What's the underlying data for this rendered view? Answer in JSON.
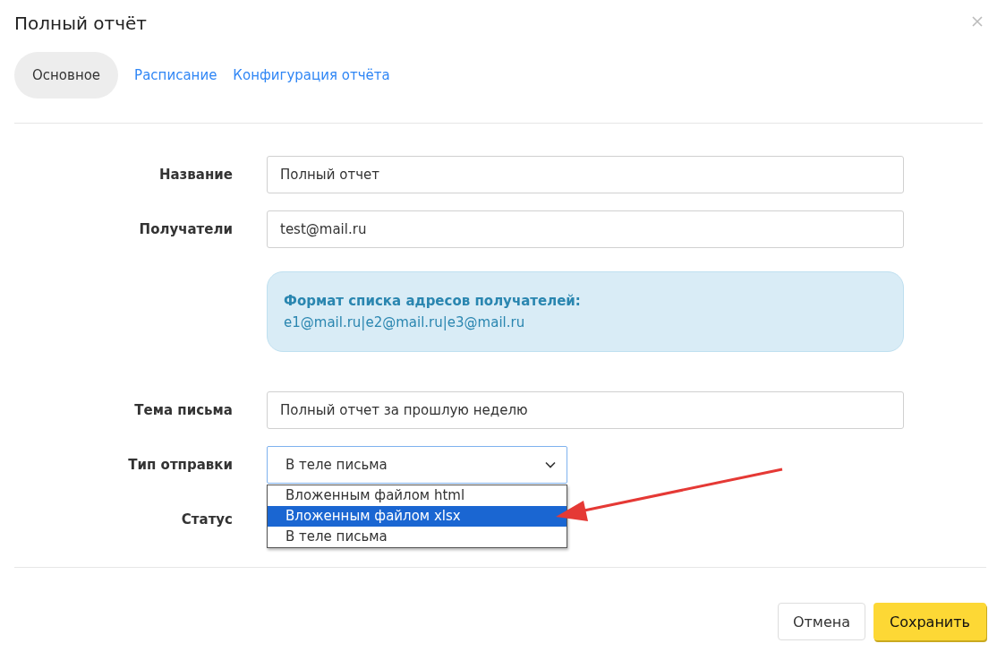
{
  "dialog": {
    "title": "Полный отчёт"
  },
  "tabs": [
    {
      "label": "Основное",
      "selected": true
    },
    {
      "label": "Расписание",
      "selected": false
    },
    {
      "label": "Конфигурация отчёта",
      "selected": false
    }
  ],
  "form": {
    "fields": [
      {
        "kind": "text",
        "label": "Название",
        "value": "Полный отчет"
      },
      {
        "kind": "text",
        "label": "Получатели",
        "value": "test@mail.ru"
      },
      {
        "kind": "hint",
        "title": "Формат списка адресов получателей:",
        "text": "e1@mail.ru|e2@mail.ru|e3@mail.ru"
      },
      {
        "kind": "text",
        "label": "Тема письма",
        "value": "Полный отчет за прошлую неделю"
      },
      {
        "kind": "select",
        "label": "Тип отправки",
        "value": "В теле письма",
        "expanded": true,
        "options": [
          {
            "label": "Вложенным файлом html",
            "highlighted": false
          },
          {
            "label": "Вложенным файлом xlsx",
            "highlighted": true
          },
          {
            "label": "В теле письма",
            "highlighted": false
          }
        ]
      },
      {
        "kind": "label",
        "label": "Статус"
      }
    ]
  },
  "buttons": [
    {
      "kind": "secondary",
      "label": "Отмена"
    },
    {
      "kind": "primary",
      "label": "Сохранить"
    }
  ]
}
